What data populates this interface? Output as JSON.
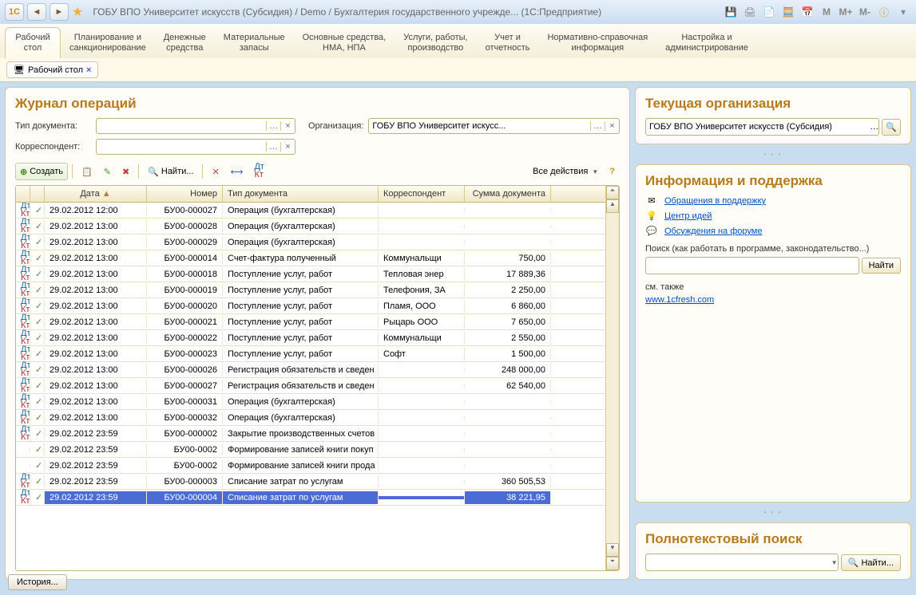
{
  "titlebar": {
    "title": "ГОБУ ВПО Университет искусств (Субсидия) / Demo / Бухгалтерия государственного учрежде... (1С:Предприятие)",
    "m1": "M",
    "m2": "M+",
    "m3": "M-"
  },
  "sections": [
    {
      "l1": "Рабочий",
      "l2": "стол"
    },
    {
      "l1": "Планирование и",
      "l2": "санкционирование"
    },
    {
      "l1": "Денежные",
      "l2": "средства"
    },
    {
      "l1": "Материальные",
      "l2": "запасы"
    },
    {
      "l1": "Основные средства,",
      "l2": "НМА, НПА"
    },
    {
      "l1": "Услуги, работы,",
      "l2": "производство"
    },
    {
      "l1": "Учет и",
      "l2": "отчетность"
    },
    {
      "l1": "Нормативно-справочная",
      "l2": "информация"
    },
    {
      "l1": "Настройка и",
      "l2": "администрирование"
    }
  ],
  "workspace_tab": "Рабочий стол",
  "journal": {
    "title": "Журнал операций",
    "type_label": "Тип документа:",
    "org_label": "Организация:",
    "org_value": "ГОБУ ВПО Университет искусс...",
    "corr_label": "Корреспондент:",
    "create": "Создать",
    "find": "Найти...",
    "all_actions": "Все действия",
    "columns": {
      "date": "Дата",
      "num": "Номер",
      "type": "Тип документа",
      "corr": "Корреспондент",
      "sum": "Сумма документа"
    },
    "rows": [
      {
        "date": "29.02.2012 12:00",
        "num": "БУ00-000027",
        "type": "Операция (бухгалтерская)",
        "corr": "",
        "sum": "",
        "dk": true
      },
      {
        "date": "29.02.2012 13:00",
        "num": "БУ00-000028",
        "type": "Операция (бухгалтерская)",
        "corr": "",
        "sum": "",
        "dk": true
      },
      {
        "date": "29.02.2012 13:00",
        "num": "БУ00-000029",
        "type": "Операция (бухгалтерская)",
        "corr": "",
        "sum": "",
        "dk": true
      },
      {
        "date": "29.02.2012 13:00",
        "num": "БУ00-000014",
        "type": "Счет-фактура полученный",
        "corr": "Коммунальщи",
        "sum": "750,00",
        "dk": true
      },
      {
        "date": "29.02.2012 13:00",
        "num": "БУ00-000018",
        "type": "Поступление услуг, работ",
        "corr": "Тепловая энер",
        "sum": "17 889,36",
        "dk": true
      },
      {
        "date": "29.02.2012 13:00",
        "num": "БУ00-000019",
        "type": "Поступление услуг, работ",
        "corr": "Телефония, ЗА",
        "sum": "2 250,00",
        "dk": true
      },
      {
        "date": "29.02.2012 13:00",
        "num": "БУ00-000020",
        "type": "Поступление услуг, работ",
        "corr": "Пламя, ООО",
        "sum": "6 860,00",
        "dk": true
      },
      {
        "date": "29.02.2012 13:00",
        "num": "БУ00-000021",
        "type": "Поступление услуг, работ",
        "corr": "Рыцарь ООО",
        "sum": "7 650,00",
        "dk": true
      },
      {
        "date": "29.02.2012 13:00",
        "num": "БУ00-000022",
        "type": "Поступление услуг, работ",
        "corr": "Коммунальщи",
        "sum": "2 550,00",
        "dk": true
      },
      {
        "date": "29.02.2012 13:00",
        "num": "БУ00-000023",
        "type": "Поступление услуг, работ",
        "corr": "Софт",
        "sum": "1 500,00",
        "dk": true
      },
      {
        "date": "29.02.2012 13:00",
        "num": "БУ00-000026",
        "type": "Регистрация обязательств и сведен",
        "corr": "",
        "sum": "248 000,00",
        "dk": true
      },
      {
        "date": "29.02.2012 13:00",
        "num": "БУ00-000027",
        "type": "Регистрация обязательств и сведен",
        "corr": "",
        "sum": "62 540,00",
        "dk": true
      },
      {
        "date": "29.02.2012 13:00",
        "num": "БУ00-000031",
        "type": "Операция (бухгалтерская)",
        "corr": "",
        "sum": "",
        "dk": true
      },
      {
        "date": "29.02.2012 13:00",
        "num": "БУ00-000032",
        "type": "Операция (бухгалтерская)",
        "corr": "",
        "sum": "",
        "dk": true
      },
      {
        "date": "29.02.2012 23:59",
        "num": "БУ00-000002",
        "type": "Закрытие производственных счетов",
        "corr": "",
        "sum": "",
        "dk": true
      },
      {
        "date": "29.02.2012 23:59",
        "num": "БУ00-0002",
        "type": "Формирование записей книги покуп",
        "corr": "",
        "sum": "",
        "dk": false
      },
      {
        "date": "29.02.2012 23:59",
        "num": "БУ00-0002",
        "type": "Формирование записей книги прода",
        "corr": "",
        "sum": "",
        "dk": false
      },
      {
        "date": "29.02.2012 23:59",
        "num": "БУ00-000003",
        "type": "Списание затрат по услугам",
        "corr": "",
        "sum": "360 505,53",
        "dk": true
      },
      {
        "date": "29.02.2012 23:59",
        "num": "БУ00-000004",
        "type": "Списание затрат по услугам",
        "corr": "",
        "sum": "38 221,95",
        "dk": true,
        "selected": true
      }
    ]
  },
  "current_org": {
    "title": "Текущая организация",
    "value": "ГОБУ ВПО Университет искусств (Субсидия)"
  },
  "info": {
    "title": "Информация и поддержка",
    "links": [
      {
        "icon": "✉",
        "text": "Обращения в поддержку"
      },
      {
        "icon": "💡",
        "text": "Центр идей"
      },
      {
        "icon": "💬",
        "text": "Обсуждения на форуме"
      }
    ],
    "search_label": "Поиск (как работать в программе, законодательство...)",
    "find_btn": "Найти",
    "see_also": "см. также",
    "fresh_link": "www.1cfresh.com"
  },
  "fulltext": {
    "title": "Полнотекстовый поиск",
    "find_btn": "Найти..."
  },
  "history_btn": "История..."
}
